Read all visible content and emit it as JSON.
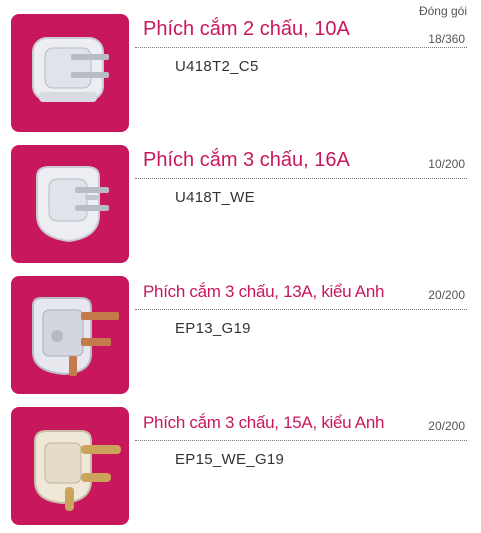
{
  "header": {
    "packing_label": "Đóng gói"
  },
  "colors": {
    "tile_bg": "#c8175d",
    "title": "#c8175d",
    "text": "#333333"
  },
  "products": [
    {
      "title": "Phích cắm 2 chấu, 10A",
      "code": "U418T2_C5",
      "packing": "18/360",
      "image_icon": "two-pin-plug-icon"
    },
    {
      "title": "Phích cắm 3 chấu, 16A",
      "code": "U418T_WE",
      "packing": "10/200",
      "image_icon": "three-pin-plug-icon"
    },
    {
      "title": "Phích cắm 3 chấu, 13A, kiểu Anh",
      "code": "EP13_G19",
      "packing": "20/200",
      "image_icon": "uk-plug-icon"
    },
    {
      "title": "Phích cắm 3 chấu, 15A, kiểu Anh",
      "code": "EP15_WE_G19",
      "packing": "20/200",
      "image_icon": "round-pin-plug-icon"
    }
  ]
}
